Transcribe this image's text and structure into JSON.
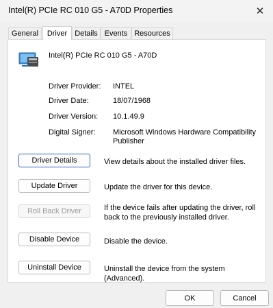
{
  "window": {
    "title": "Intel(R) PCIe RC 010 G5 - A70D Properties",
    "close_icon": "close-icon"
  },
  "tabs": [
    {
      "label": "General",
      "active": false
    },
    {
      "label": "Driver",
      "active": true
    },
    {
      "label": "Details",
      "active": false
    },
    {
      "label": "Events",
      "active": false
    },
    {
      "label": "Resources",
      "active": false
    }
  ],
  "device": {
    "name": "Intel(R) PCIe RC 010 G5 - A70D",
    "icon": "device-icon"
  },
  "driver_info": [
    {
      "label": "Driver Provider:",
      "value": "INTEL"
    },
    {
      "label": "Driver Date:",
      "value": "18/07/1968"
    },
    {
      "label": "Driver Version:",
      "value": "10.1.49.9"
    },
    {
      "label": "Digital Signer:",
      "value": "Microsoft Windows Hardware Compatibility Publisher"
    }
  ],
  "actions": [
    {
      "label": "Driver Details",
      "description": "View details about the installed driver files.",
      "enabled": true
    },
    {
      "label": "Update Driver",
      "description": "Update the driver for this device.",
      "enabled": true
    },
    {
      "label": "Roll Back Driver",
      "description": "If the device fails after updating the driver, roll back to the previously installed driver.",
      "enabled": false
    },
    {
      "label": "Disable Device",
      "description": "Disable the device.",
      "enabled": true
    },
    {
      "label": "Uninstall Device",
      "description": "Uninstall the device from the system (Advanced).",
      "enabled": true
    }
  ],
  "footer": {
    "ok_label": "OK",
    "cancel_label": "Cancel"
  }
}
